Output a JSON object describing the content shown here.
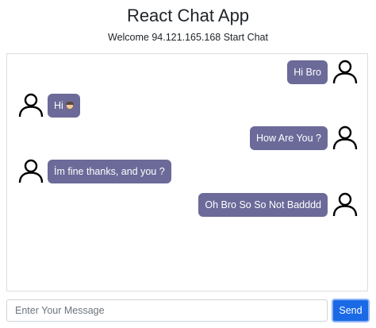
{
  "header": {
    "title": "React Chat App",
    "welcome": "Welcome 94.121.165.168 Start Chat"
  },
  "messages": [
    {
      "side": "right",
      "text": "Hi Bro"
    },
    {
      "side": "left",
      "text": "Hi",
      "emoji": "face-emoji"
    },
    {
      "side": "right",
      "text": "How Are You ?"
    },
    {
      "side": "left",
      "text": "İm fine thanks, and you ?"
    },
    {
      "side": "right",
      "text": "Oh Bro So So Not Badddd"
    }
  ],
  "composer": {
    "placeholder": "Enter Your Message",
    "value": "",
    "send_label": "Send"
  },
  "colors": {
    "bubble": "#6c6a99",
    "send": "#1a6ae6"
  },
  "icons": {
    "avatar": "user-icon"
  }
}
